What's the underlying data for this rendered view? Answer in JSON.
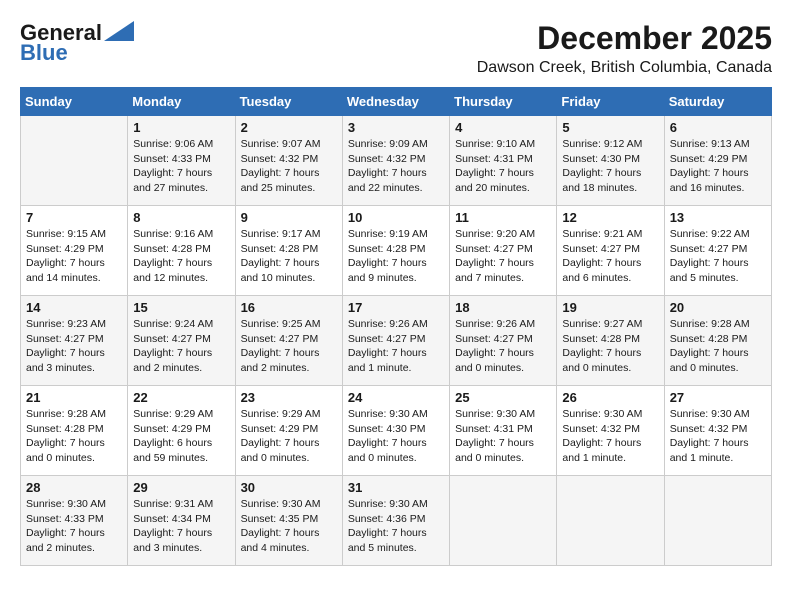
{
  "logo": {
    "line1": "General",
    "line2": "Blue"
  },
  "title": "December 2025",
  "subtitle": "Dawson Creek, British Columbia, Canada",
  "days_of_week": [
    "Sunday",
    "Monday",
    "Tuesday",
    "Wednesday",
    "Thursday",
    "Friday",
    "Saturday"
  ],
  "weeks": [
    [
      {
        "day": "",
        "info": ""
      },
      {
        "day": "1",
        "info": "Sunrise: 9:06 AM\nSunset: 4:33 PM\nDaylight: 7 hours\nand 27 minutes."
      },
      {
        "day": "2",
        "info": "Sunrise: 9:07 AM\nSunset: 4:32 PM\nDaylight: 7 hours\nand 25 minutes."
      },
      {
        "day": "3",
        "info": "Sunrise: 9:09 AM\nSunset: 4:32 PM\nDaylight: 7 hours\nand 22 minutes."
      },
      {
        "day": "4",
        "info": "Sunrise: 9:10 AM\nSunset: 4:31 PM\nDaylight: 7 hours\nand 20 minutes."
      },
      {
        "day": "5",
        "info": "Sunrise: 9:12 AM\nSunset: 4:30 PM\nDaylight: 7 hours\nand 18 minutes."
      },
      {
        "day": "6",
        "info": "Sunrise: 9:13 AM\nSunset: 4:29 PM\nDaylight: 7 hours\nand 16 minutes."
      }
    ],
    [
      {
        "day": "7",
        "info": "Sunrise: 9:15 AM\nSunset: 4:29 PM\nDaylight: 7 hours\nand 14 minutes."
      },
      {
        "day": "8",
        "info": "Sunrise: 9:16 AM\nSunset: 4:28 PM\nDaylight: 7 hours\nand 12 minutes."
      },
      {
        "day": "9",
        "info": "Sunrise: 9:17 AM\nSunset: 4:28 PM\nDaylight: 7 hours\nand 10 minutes."
      },
      {
        "day": "10",
        "info": "Sunrise: 9:19 AM\nSunset: 4:28 PM\nDaylight: 7 hours\nand 9 minutes."
      },
      {
        "day": "11",
        "info": "Sunrise: 9:20 AM\nSunset: 4:27 PM\nDaylight: 7 hours\nand 7 minutes."
      },
      {
        "day": "12",
        "info": "Sunrise: 9:21 AM\nSunset: 4:27 PM\nDaylight: 7 hours\nand 6 minutes."
      },
      {
        "day": "13",
        "info": "Sunrise: 9:22 AM\nSunset: 4:27 PM\nDaylight: 7 hours\nand 5 minutes."
      }
    ],
    [
      {
        "day": "14",
        "info": "Sunrise: 9:23 AM\nSunset: 4:27 PM\nDaylight: 7 hours\nand 3 minutes."
      },
      {
        "day": "15",
        "info": "Sunrise: 9:24 AM\nSunset: 4:27 PM\nDaylight: 7 hours\nand 2 minutes."
      },
      {
        "day": "16",
        "info": "Sunrise: 9:25 AM\nSunset: 4:27 PM\nDaylight: 7 hours\nand 2 minutes."
      },
      {
        "day": "17",
        "info": "Sunrise: 9:26 AM\nSunset: 4:27 PM\nDaylight: 7 hours\nand 1 minute."
      },
      {
        "day": "18",
        "info": "Sunrise: 9:26 AM\nSunset: 4:27 PM\nDaylight: 7 hours\nand 0 minutes."
      },
      {
        "day": "19",
        "info": "Sunrise: 9:27 AM\nSunset: 4:28 PM\nDaylight: 7 hours\nand 0 minutes."
      },
      {
        "day": "20",
        "info": "Sunrise: 9:28 AM\nSunset: 4:28 PM\nDaylight: 7 hours\nand 0 minutes."
      }
    ],
    [
      {
        "day": "21",
        "info": "Sunrise: 9:28 AM\nSunset: 4:28 PM\nDaylight: 7 hours\nand 0 minutes."
      },
      {
        "day": "22",
        "info": "Sunrise: 9:29 AM\nSunset: 4:29 PM\nDaylight: 6 hours\nand 59 minutes."
      },
      {
        "day": "23",
        "info": "Sunrise: 9:29 AM\nSunset: 4:29 PM\nDaylight: 7 hours\nand 0 minutes."
      },
      {
        "day": "24",
        "info": "Sunrise: 9:30 AM\nSunset: 4:30 PM\nDaylight: 7 hours\nand 0 minutes."
      },
      {
        "day": "25",
        "info": "Sunrise: 9:30 AM\nSunset: 4:31 PM\nDaylight: 7 hours\nand 0 minutes."
      },
      {
        "day": "26",
        "info": "Sunrise: 9:30 AM\nSunset: 4:32 PM\nDaylight: 7 hours\nand 1 minute."
      },
      {
        "day": "27",
        "info": "Sunrise: 9:30 AM\nSunset: 4:32 PM\nDaylight: 7 hours\nand 1 minute."
      }
    ],
    [
      {
        "day": "28",
        "info": "Sunrise: 9:30 AM\nSunset: 4:33 PM\nDaylight: 7 hours\nand 2 minutes."
      },
      {
        "day": "29",
        "info": "Sunrise: 9:31 AM\nSunset: 4:34 PM\nDaylight: 7 hours\nand 3 minutes."
      },
      {
        "day": "30",
        "info": "Sunrise: 9:30 AM\nSunset: 4:35 PM\nDaylight: 7 hours\nand 4 minutes."
      },
      {
        "day": "31",
        "info": "Sunrise: 9:30 AM\nSunset: 4:36 PM\nDaylight: 7 hours\nand 5 minutes."
      },
      {
        "day": "",
        "info": ""
      },
      {
        "day": "",
        "info": ""
      },
      {
        "day": "",
        "info": ""
      }
    ]
  ]
}
